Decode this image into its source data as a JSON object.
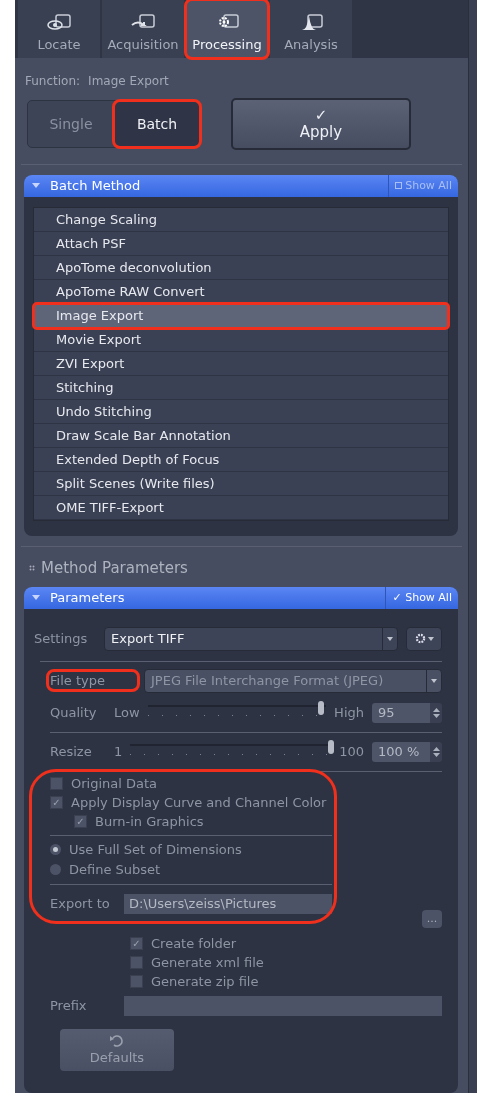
{
  "tabs": [
    {
      "label": "Locate",
      "selected": false,
      "highlighted": false
    },
    {
      "label": "Acquisition",
      "selected": false,
      "highlighted": false
    },
    {
      "label": "Processing",
      "selected": true,
      "highlighted": true
    },
    {
      "label": "Analysis",
      "selected": false,
      "highlighted": false
    }
  ],
  "function": {
    "label": "Function:",
    "value": "Image Export"
  },
  "mode": [
    {
      "label": "Single",
      "selected": false,
      "highlighted": false
    },
    {
      "label": "Batch",
      "selected": true,
      "highlighted": true
    }
  ],
  "apply": {
    "label": "Apply",
    "icon": "✓"
  },
  "batch_method": {
    "title": "Batch Method",
    "show_all": {
      "label": "Show All",
      "checked": false
    },
    "items": [
      {
        "label": "Change Scaling",
        "selected": false,
        "highlighted": false
      },
      {
        "label": "Attach PSF",
        "selected": false,
        "highlighted": false
      },
      {
        "label": "ApoTome deconvolution",
        "selected": false,
        "highlighted": false
      },
      {
        "label": "ApoTome RAW Convert",
        "selected": false,
        "highlighted": false
      },
      {
        "label": "Image Export",
        "selected": true,
        "highlighted": true
      },
      {
        "label": "Movie Export",
        "selected": false,
        "highlighted": false
      },
      {
        "label": "ZVI Export",
        "selected": false,
        "highlighted": false
      },
      {
        "label": "Stitching",
        "selected": false,
        "highlighted": false
      },
      {
        "label": "Undo Stitching",
        "selected": false,
        "highlighted": false
      },
      {
        "label": "Draw Scale Bar Annotation",
        "selected": false,
        "highlighted": false
      },
      {
        "label": "Extended Depth of Focus",
        "selected": false,
        "highlighted": false
      },
      {
        "label": "Split Scenes (Write files)",
        "selected": false,
        "highlighted": false
      },
      {
        "label": "OME TIFF-Export",
        "selected": false,
        "highlighted": false
      }
    ]
  },
  "method_parameters": {
    "title": "Method Parameters"
  },
  "parameters": {
    "title": "Parameters",
    "show_all": {
      "label": "Show All",
      "checked": true
    },
    "settings": {
      "label": "Settings",
      "value": "Export TIFF"
    },
    "file_type": {
      "label": "File type",
      "value": "JPEG File Interchange Format (JPEG)",
      "highlighted": true
    },
    "quality": {
      "label": "Quality",
      "min_label": "Low",
      "max_label": "High",
      "level": 0.97,
      "value": "95"
    },
    "resize": {
      "label": "Resize",
      "min_label": "1",
      "max_label": "100",
      "level": 1.0,
      "value": "100 %"
    },
    "options_highlighted": true,
    "checkboxes": [
      {
        "label": "Original Data",
        "checked": false
      },
      {
        "label": "Apply Display Curve and Channel Color",
        "checked": true,
        "children": [
          {
            "label": "Burn-in Graphics",
            "checked": true
          }
        ]
      }
    ],
    "radios": [
      {
        "label": "Use Full Set of Dimensions",
        "selected": true
      },
      {
        "label": "Define Subset",
        "selected": false
      }
    ],
    "export_to": {
      "label": "Export to",
      "value": "D:\\Users\\zeiss\\Pictures",
      "browse": "..."
    },
    "export_options": [
      {
        "label": "Create folder",
        "checked": true
      },
      {
        "label": "Generate xml file",
        "checked": false
      },
      {
        "label": "Generate zip file",
        "checked": false
      }
    ],
    "prefix": {
      "label": "Prefix"
    },
    "defaults": {
      "label": "Defaults"
    }
  }
}
